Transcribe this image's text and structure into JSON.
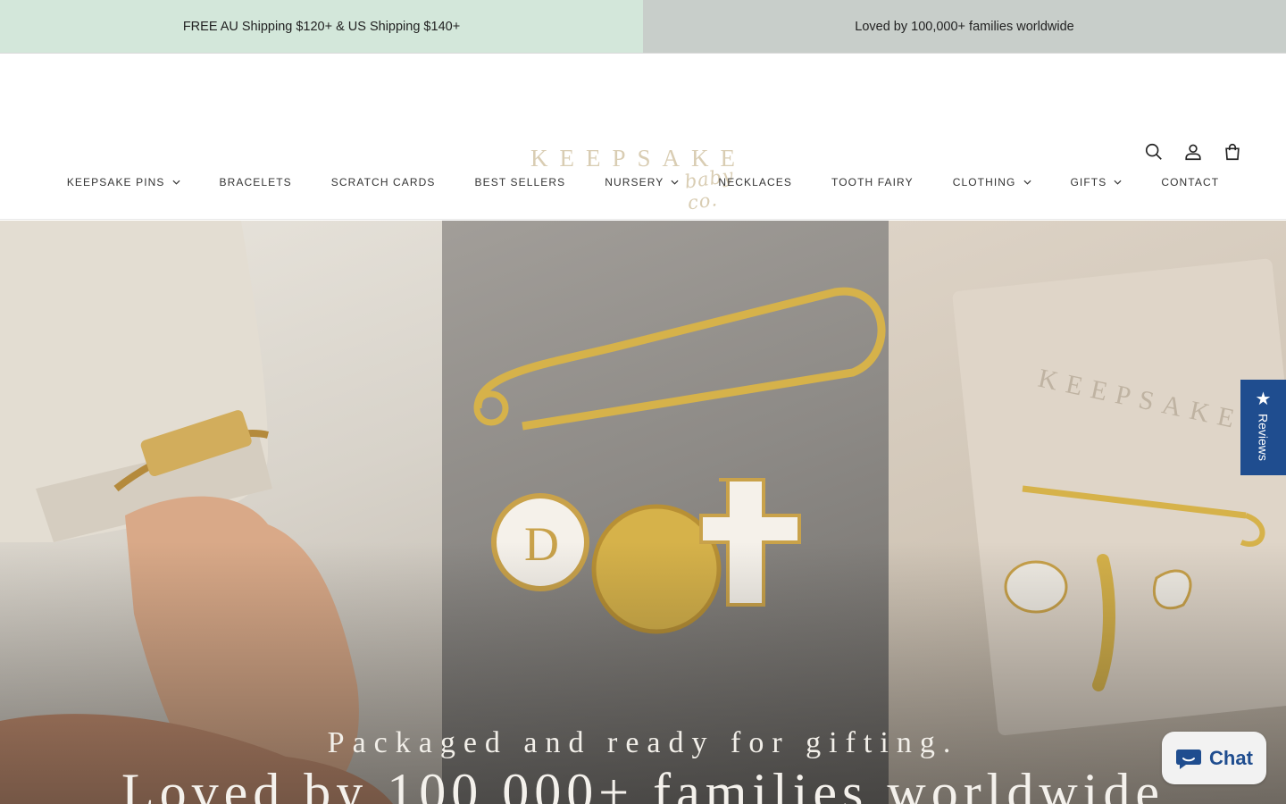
{
  "announcement": {
    "left": "FREE AU Shipping $120+ & US Shipping $140+",
    "right": "Loved by 100,000+ families worldwide"
  },
  "header": {
    "logo_word": "KEEPSAKE",
    "logo_sub": "baby co.",
    "icons": [
      "search-icon",
      "account-icon",
      "cart-icon"
    ]
  },
  "nav": {
    "items": [
      {
        "label": "KEEPSAKE PINS",
        "has_dropdown": true
      },
      {
        "label": "BRACELETS",
        "has_dropdown": false
      },
      {
        "label": "SCRATCH CARDS",
        "has_dropdown": false
      },
      {
        "label": "BEST SELLERS",
        "has_dropdown": false
      },
      {
        "label": "NURSERY",
        "has_dropdown": true
      },
      {
        "label": "NECKLACES",
        "has_dropdown": false
      },
      {
        "label": "TOOTH FAIRY",
        "has_dropdown": false
      },
      {
        "label": "CLOTHING",
        "has_dropdown": true
      },
      {
        "label": "GIFTS",
        "has_dropdown": true
      },
      {
        "label": "CONTACT",
        "has_dropdown": false
      }
    ]
  },
  "hero": {
    "subtitle": "Packaged and ready for gifting.",
    "title": "Loved by 100,000+ families worldwide"
  },
  "reviews_tab": {
    "star": "★",
    "label": "Reviews"
  },
  "chat": {
    "label": "Chat"
  },
  "colors": {
    "announce_left": "#d3e7da",
    "announce_right": "#c8ceca",
    "brand_blue": "#1f4d8f",
    "logo_tan": "#d9cdb3"
  }
}
